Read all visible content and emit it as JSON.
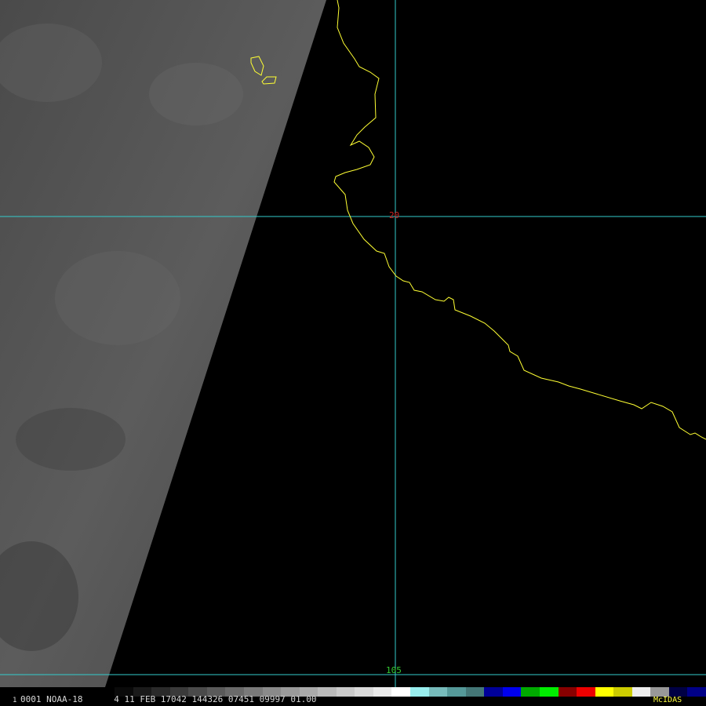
{
  "satellite": {
    "frame_prefix": "1",
    "status_line": "0001 NOAA-18      4 11 FEB 17042 144326 07451 09997 01.00",
    "brand": "McIDAS"
  },
  "grid": {
    "latitude_label": "20",
    "longitude_label": "105"
  },
  "colors": {
    "background": "#000000",
    "coastline": "#ffff33",
    "gridline": "#33cccc",
    "latitude_label": "#cc2222",
    "longitude_label": "#33cc33",
    "status_text": "#d8d8d8",
    "brand": "#ffff44",
    "imagery_gray": "#555555"
  },
  "legend_colors": [
    "#0a0a0a",
    "#1a1a1a",
    "#2a2a2a",
    "#3a3a3a",
    "#4a4a4a",
    "#5a5a5a",
    "#6a6a6a",
    "#7a7a7a",
    "#8a8a8a",
    "#9a9a9a",
    "#aaaaaa",
    "#bababa",
    "#cacaca",
    "#dadada",
    "#eaeaea",
    "#ffffff",
    "#99eeee",
    "#77bbbb",
    "#559999",
    "#447777",
    "#000099",
    "#0000ee",
    "#00aa00",
    "#00ee00",
    "#880000",
    "#ee0000",
    "#ffff00",
    "#cccc00",
    "#eeeeee",
    "#999999",
    "#000044",
    "#000088"
  ]
}
